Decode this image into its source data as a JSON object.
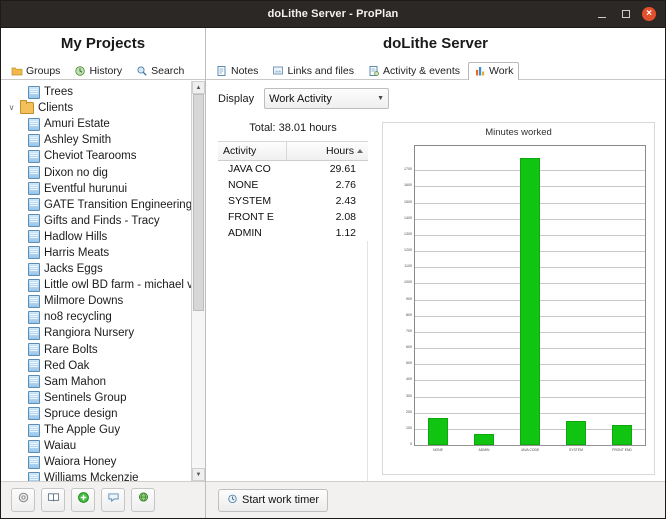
{
  "window": {
    "title": "doLithe Server - ProPlan",
    "minimize_label": "",
    "maximize_label": "",
    "close_label": "×"
  },
  "left_panel": {
    "title": "My Projects",
    "tabs": [
      {
        "label": "Groups",
        "icon": "folder-icon",
        "active": false
      },
      {
        "label": "History",
        "icon": "history-icon",
        "active": false
      },
      {
        "label": "Search",
        "icon": "magnifier-icon",
        "active": false
      }
    ],
    "tree": [
      {
        "label": "Trees",
        "level": 2,
        "type": "document",
        "expandable": false
      },
      {
        "label": "Clients",
        "level": 1,
        "type": "folder",
        "expandable": true,
        "twisty": "∨"
      },
      {
        "label": "Amuri Estate",
        "level": 2,
        "type": "document",
        "expandable": false
      },
      {
        "label": "Ashley Smith",
        "level": 2,
        "type": "document",
        "expandable": false
      },
      {
        "label": "Cheviot Tearooms",
        "level": 2,
        "type": "document",
        "expandable": false
      },
      {
        "label": "Dixon no dig",
        "level": 2,
        "type": "document",
        "expandable": false
      },
      {
        "label": "Eventful hurunui",
        "level": 2,
        "type": "document",
        "expandable": false
      },
      {
        "label": "GATE Transition Engineering",
        "level": 2,
        "type": "document",
        "expandable": false
      },
      {
        "label": "Gifts and Finds - Tracy",
        "level": 2,
        "type": "document",
        "expandable": false
      },
      {
        "label": "Hadlow Hills",
        "level": 2,
        "type": "document",
        "expandable": false
      },
      {
        "label": "Harris Meats",
        "level": 2,
        "type": "document",
        "expandable": false
      },
      {
        "label": "Jacks Eggs",
        "level": 2,
        "type": "document",
        "expandable": false
      },
      {
        "label": "Little owl BD farm - michael vo",
        "level": 2,
        "type": "document",
        "expandable": false
      },
      {
        "label": "Milmore Downs",
        "level": 2,
        "type": "document",
        "expandable": false
      },
      {
        "label": "no8 recycling",
        "level": 2,
        "type": "document",
        "expandable": false
      },
      {
        "label": "Rangiora Nursery",
        "level": 2,
        "type": "document",
        "expandable": false
      },
      {
        "label": "Rare Bolts",
        "level": 2,
        "type": "document",
        "expandable": false
      },
      {
        "label": "Red Oak",
        "level": 2,
        "type": "document",
        "expandable": false
      },
      {
        "label": "Sam Mahon",
        "level": 2,
        "type": "document",
        "expandable": false
      },
      {
        "label": "Sentinels Group",
        "level": 2,
        "type": "document",
        "expandable": false
      },
      {
        "label": "Spruce design",
        "level": 2,
        "type": "document",
        "expandable": false
      },
      {
        "label": "The Apple Guy",
        "level": 2,
        "type": "document",
        "expandable": false
      },
      {
        "label": "Waiau",
        "level": 2,
        "type": "document",
        "expandable": false
      },
      {
        "label": "Waiora Honey",
        "level": 2,
        "type": "document",
        "expandable": false
      },
      {
        "label": "Williams Mckenzie",
        "level": 2,
        "type": "document",
        "expandable": false
      }
    ],
    "scrollbar": {
      "up_arrow": "▲",
      "down_arrow": "▼"
    },
    "toolbar": [
      {
        "icon": "gear-icon"
      },
      {
        "icon": "book-icon"
      },
      {
        "icon": "add-plus-icon"
      },
      {
        "icon": "comment-icon"
      },
      {
        "icon": "globe-icon"
      }
    ]
  },
  "right_panel": {
    "title": "doLithe Server",
    "tabs": [
      {
        "label": "Notes",
        "icon": "notes-icon",
        "active": false
      },
      {
        "label": "Links and files",
        "icon": "links-icon",
        "active": false
      },
      {
        "label": "Activity & events",
        "icon": "activity-icon",
        "active": false
      },
      {
        "label": "Work",
        "icon": "bar-chart-icon",
        "active": true
      }
    ],
    "display": {
      "label": "Display",
      "selected": "Work Activity",
      "caret": "▼",
      "options": [
        "Work Activity"
      ]
    },
    "table": {
      "total_text": "Total: 38.01 hours",
      "columns": [
        "Activity",
        "Hours"
      ],
      "sort_column": "Hours",
      "sort_direction": "asc",
      "rows": [
        {
          "activity": "JAVA CO",
          "hours": "29.61"
        },
        {
          "activity": "NONE",
          "hours": "2.76"
        },
        {
          "activity": "SYSTEM",
          "hours": "2.43"
        },
        {
          "activity": "FRONT E",
          "hours": "2.08"
        },
        {
          "activity": "ADMIN",
          "hours": "1.12"
        }
      ]
    },
    "start_timer_button": {
      "label": "Start work timer",
      "icon": "timer-icon"
    }
  },
  "chart_data": {
    "type": "bar",
    "title": "Minutes worked",
    "xlabel": "",
    "ylabel": "",
    "categories": [
      "NONE",
      "ADMIN",
      "JAVA CODE",
      "SYSTEM",
      "FRONT END"
    ],
    "values": [
      166,
      67,
      1777,
      146,
      125
    ],
    "ylim": [
      0,
      1850
    ],
    "yticks": [
      0,
      100,
      200,
      300,
      400,
      500,
      600,
      700,
      800,
      900,
      1000,
      1100,
      1200,
      1300,
      1400,
      1500,
      1600,
      1700
    ],
    "grid": true,
    "legend": false,
    "bar_color": "#12c412"
  }
}
